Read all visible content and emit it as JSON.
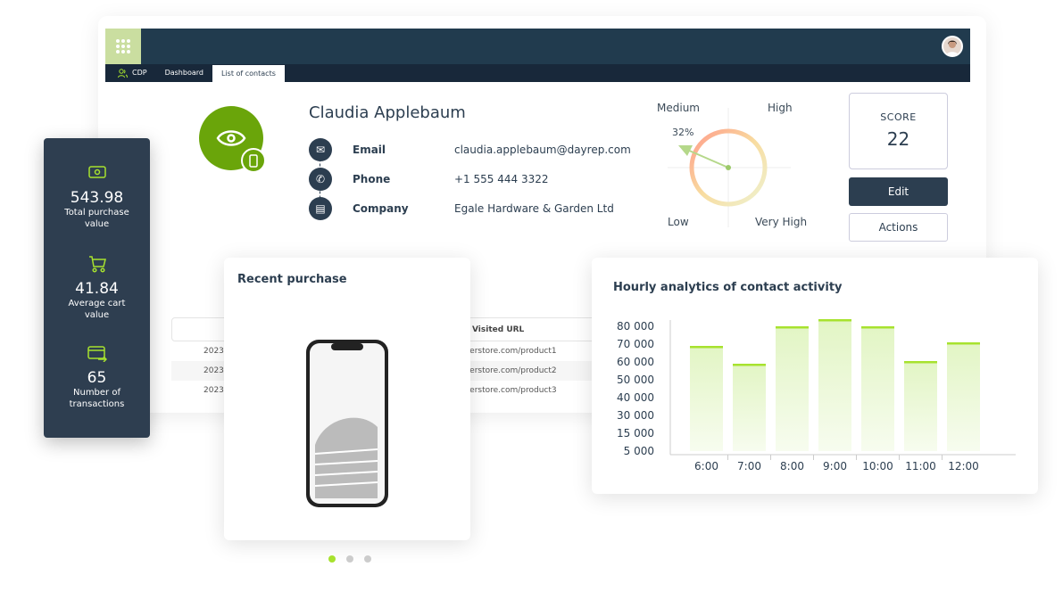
{
  "nav": {
    "tabs": [
      {
        "label": "CDP",
        "icon": "users-icon"
      },
      {
        "label": "Dashboard"
      },
      {
        "label": "List of contacts",
        "active": true
      }
    ]
  },
  "contact": {
    "name": "Claudia Applebaum",
    "fields": [
      {
        "label": "Email",
        "value": "claudia.applebaum@dayrep.com",
        "icon": "mail-icon"
      },
      {
        "label": "Phone",
        "value": "+1 555 444 3322",
        "icon": "phone-icon"
      },
      {
        "label": "Company",
        "value": "Egale Hardware & Garden Ltd",
        "icon": "building-icon"
      }
    ]
  },
  "gauge": {
    "labels": {
      "tl": "Medium",
      "tr": "High",
      "bl": "Low",
      "br": "Very High"
    },
    "value": "32%"
  },
  "score": {
    "label": "SCORE",
    "value": "22"
  },
  "buttons": {
    "edit": "Edit",
    "actions": "Actions"
  },
  "table": {
    "header": "Visited URL",
    "rows": [
      {
        "date": "2023-",
        "url": "erstore.com/product1"
      },
      {
        "date": "2023-",
        "url": "erstore.com/product2"
      },
      {
        "date": "2023-",
        "url": "erstore.com/product3"
      }
    ]
  },
  "stats": [
    {
      "value": "543.98",
      "label": "Total purchase value",
      "icon": "money-icon"
    },
    {
      "value": "41.84",
      "label": "Average cart value",
      "icon": "cart-icon"
    },
    {
      "value": "65",
      "label": "Number of transactions",
      "icon": "card-transfer-icon"
    }
  ],
  "purchase": {
    "title": "Recent purchase",
    "carousel_active": 1,
    "carousel_count": 3
  },
  "colors": {
    "accent": "#6aa50a",
    "navy": "#213b4e",
    "lime": "#a7e22e"
  },
  "chart_data": {
    "type": "bar",
    "title": "Hourly analytics of contact activity",
    "categories": [
      "6:00",
      "7:00",
      "8:00",
      "9:00",
      "10:00",
      "11:00",
      "12:00"
    ],
    "values": [
      69000,
      59000,
      80000,
      84000,
      80000,
      60500,
      71000
    ],
    "yticks": [
      80000,
      70000,
      60000,
      50000,
      40000,
      30000,
      15000,
      5000
    ],
    "ytick_labels": [
      "80 000",
      "70 000",
      "60 000",
      "50 000",
      "40 000",
      "30 000",
      "15 000",
      "5 000"
    ],
    "grid": false
  }
}
